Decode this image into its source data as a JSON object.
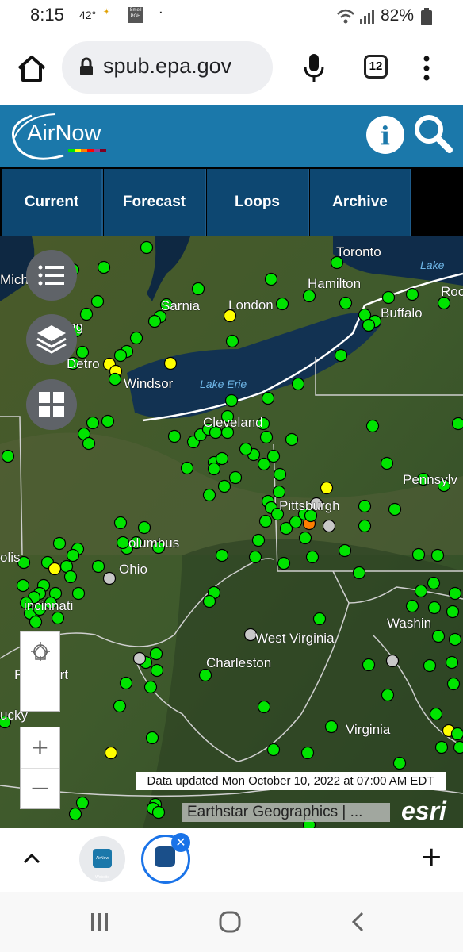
{
  "status_bar": {
    "time": "8:15",
    "temperature": "42°",
    "notification_icon": "Smell PGH",
    "battery": "82%"
  },
  "browser": {
    "url": "spub.epa.gov",
    "tab_count": "12"
  },
  "header": {
    "logo_text": "AirNow",
    "info_icon": "info-icon",
    "search_icon": "search-icon"
  },
  "nav": {
    "tabs": [
      {
        "label": "Current"
      },
      {
        "label": "Forecast"
      },
      {
        "label": "Loops"
      },
      {
        "label": "Archive"
      }
    ]
  },
  "map": {
    "place_labels": [
      {
        "name": "Toronto"
      },
      {
        "name": "Lake"
      },
      {
        "name": "Mich"
      },
      {
        "name": "Hamilton"
      },
      {
        "name": "Roc"
      },
      {
        "name": "Sarnia"
      },
      {
        "name": "London"
      },
      {
        "name": "Buffalo"
      },
      {
        "name": "ng"
      },
      {
        "name": "Detro"
      },
      {
        "name": "Windsor"
      },
      {
        "name": "Lake Erie"
      },
      {
        "name": "Cleveland"
      },
      {
        "name": "Pennsylv"
      },
      {
        "name": "Pittsburgh"
      },
      {
        "name": "olis"
      },
      {
        "name": "olumbus"
      },
      {
        "name": "Ohio"
      },
      {
        "name": "incinnati"
      },
      {
        "name": "Washin"
      },
      {
        "name": "West Virginia"
      },
      {
        "name": "Charleston"
      },
      {
        "name": "Frankfort"
      },
      {
        "name": "Virginia"
      },
      {
        "name": "ucky"
      }
    ],
    "colors": {
      "good": "#00e400",
      "moderate": "#ffff00",
      "usg": "#ff7e00",
      "no_data": "#c8c8c8"
    },
    "updated_text": "Data updated Mon October 10, 2022 at 07:00 AM EDT",
    "attribution": "Earthstar Geographics | ...",
    "esri_logo": "esri",
    "controls": {
      "legend_icon": "list-icon",
      "layers_icon": "layers-icon",
      "basemap_icon": "grid-icon",
      "locate_icon": "crosshair-icon",
      "home_icon": "home-icon",
      "zoom_in": "+",
      "zoom_out": "—"
    }
  },
  "tab_strip": {
    "up_icon": "chevron-up-icon",
    "app_label": "AirNow Website",
    "new_tab": "+"
  },
  "system_nav": {
    "recent_icon": "recents-icon",
    "home_icon": "home-circle-icon",
    "back_icon": "back-icon"
  }
}
